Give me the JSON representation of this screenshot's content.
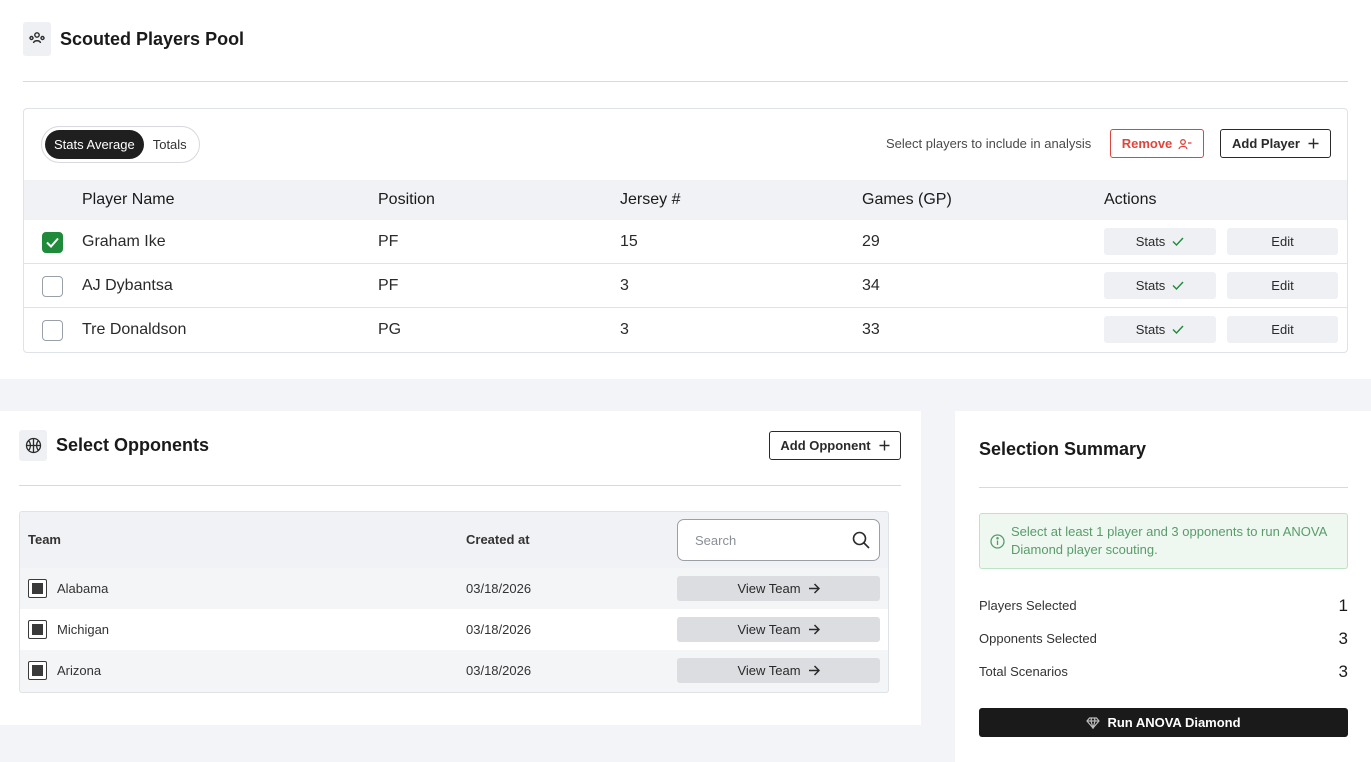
{
  "players_section": {
    "title": "Scouted Players Pool",
    "toggle": {
      "options": [
        "Stats Average",
        "Totals"
      ],
      "active": "Stats Average"
    },
    "hint": "Select players to include in analysis",
    "remove_label": "Remove",
    "add_player_label": "Add Player",
    "columns": [
      "Player Name",
      "Position",
      "Jersey #",
      "Games (GP)",
      "Actions"
    ],
    "rows": [
      {
        "name": "Graham Ike",
        "position": "PF",
        "jersey": "15",
        "games": "29",
        "checked": true
      },
      {
        "name": "AJ Dybantsa",
        "position": "PF",
        "jersey": "3",
        "games": "34",
        "checked": false
      },
      {
        "name": "Tre Donaldson",
        "position": "PG",
        "jersey": "3",
        "games": "33",
        "checked": false
      }
    ],
    "stats_label": "Stats",
    "edit_label": "Edit"
  },
  "opponents_section": {
    "title": "Select Opponents",
    "add_opponent_label": "Add Opponent",
    "columns": [
      "Team",
      "Created at"
    ],
    "search_placeholder": "Search",
    "rows": [
      {
        "team": "Alabama",
        "created_at": "03/18/2026"
      },
      {
        "team": "Michigan",
        "created_at": "03/18/2026"
      },
      {
        "team": "Arizona",
        "created_at": "03/18/2026"
      }
    ],
    "view_team_label": "View Team"
  },
  "summary": {
    "title": "Selection Summary",
    "notice": "Select at least 1 player and 3 opponents to run ANOVA Diamond player scouting.",
    "stats": [
      {
        "label": "Players Selected",
        "value": "1"
      },
      {
        "label": "Opponents Selected",
        "value": "3"
      },
      {
        "label": "Total Scenarios",
        "value": "3"
      }
    ],
    "run_label": "Run ANOVA Diamond"
  },
  "colors": {
    "accent_green": "#1f8a3a",
    "danger": "#e0453c",
    "dark": "#1a1a1a"
  }
}
